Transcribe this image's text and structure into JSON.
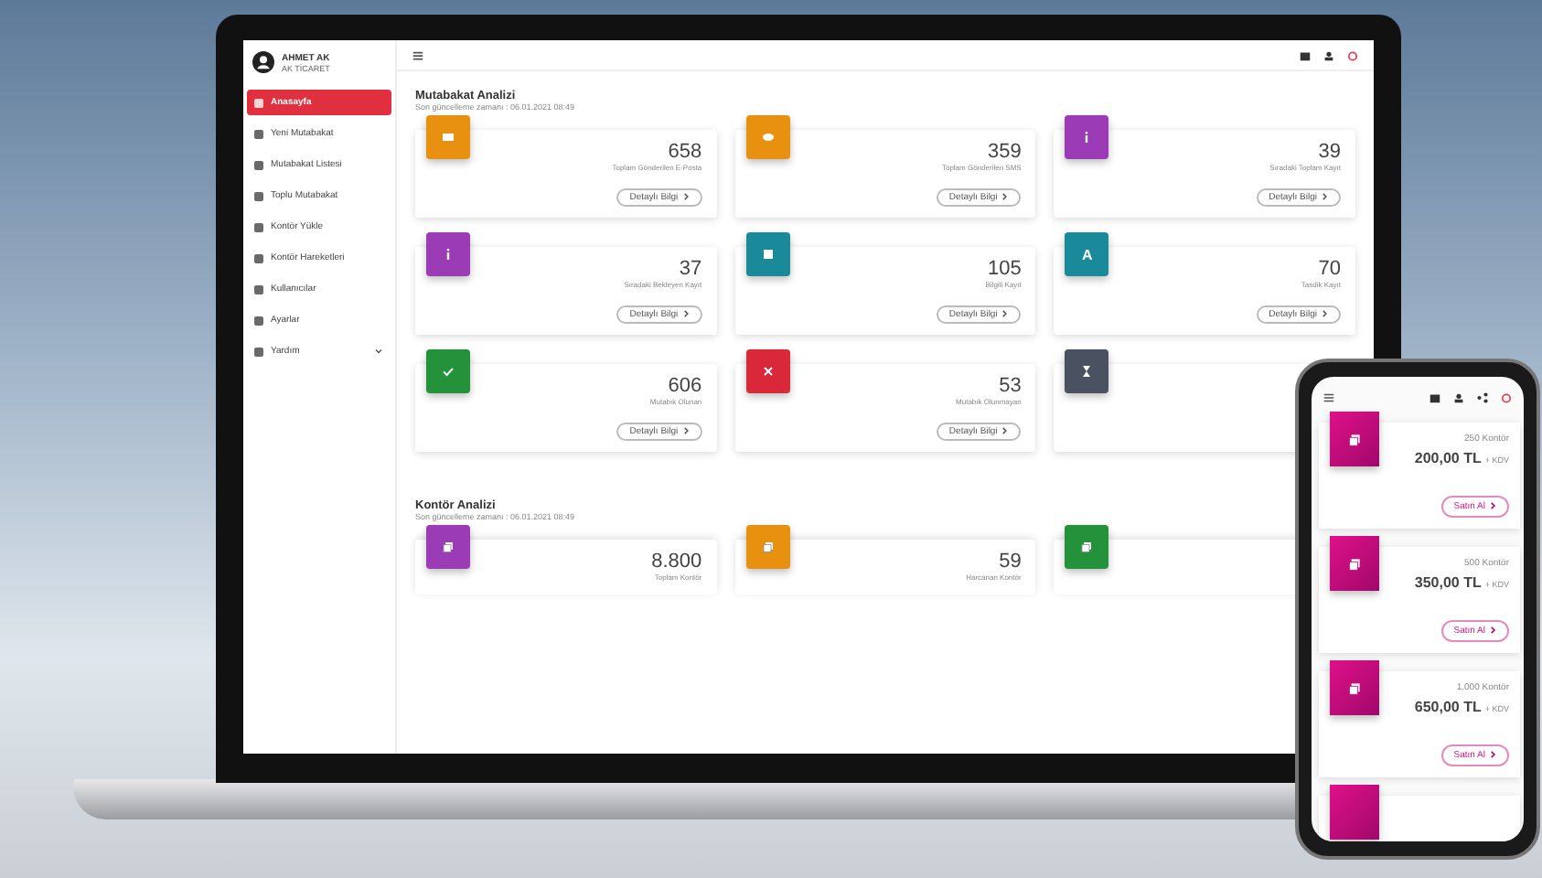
{
  "user": {
    "name": "AHMET AK",
    "company": "AK TİCARET"
  },
  "sidebar": {
    "items": [
      {
        "label": "Anasayfa",
        "selected": true
      },
      {
        "label": "Yeni Mutabakat",
        "selected": false
      },
      {
        "label": "Mutabakat Listesi",
        "selected": false
      },
      {
        "label": "Toplu Mutabakat",
        "selected": false
      },
      {
        "label": "Kontör Yükle",
        "selected": false
      },
      {
        "label": "Kontör Hareketleri",
        "selected": false
      },
      {
        "label": "Kullanıcılar",
        "selected": false
      },
      {
        "label": "Ayarlar",
        "selected": false
      },
      {
        "label": "Yardım",
        "selected": false,
        "expandable": true
      }
    ]
  },
  "sections": [
    {
      "title": "Mutabakat Analizi",
      "updated": "Son güncelleme zamanı : 06.01.2021 08:49",
      "cards": [
        {
          "color": "#e8900f",
          "value": "658",
          "label": "Toplam Gönderilen E-Posta",
          "button": "Detaylı Bilgi"
        },
        {
          "color": "#e8900f",
          "value": "359",
          "label": "Toplam Gönderilen SMS",
          "button": "Detaylı Bilgi"
        },
        {
          "color": "#9b3bb5",
          "value": "39",
          "label": "Sıradaki Toplam Kayıt",
          "button": "Detaylı Bilgi"
        },
        {
          "color": "#9b3bb5",
          "value": "37",
          "label": "Sıradaki Bekleyen Kayıt",
          "button": "Detaylı Bilgi"
        },
        {
          "color": "#1a8a9a",
          "value": "105",
          "label": "Bilgili Kayıt",
          "button": "Detaylı Bilgi"
        },
        {
          "color": "#1a8a9a",
          "icon_text": "A",
          "value": "70",
          "label": "Tasdik Kayıt",
          "button": "Detaylı Bilgi"
        },
        {
          "color": "#23923a",
          "value": "606",
          "label": "Mutabık Olunan",
          "button": "Detaylı Bilgi"
        },
        {
          "color": "#d8283a",
          "value": "53",
          "label": "Mutabık Olunmayan",
          "button": "Detaylı Bilgi"
        },
        {
          "color": "#4a5160"
        }
      ]
    },
    {
      "title": "Kontör Analizi",
      "updated": "Son güncelleme zamanı : 06.01.2021 08:49",
      "cards": [
        {
          "color": "#9b3bb5",
          "value": "8.800",
          "label": "Toplam Kontör"
        },
        {
          "color": "#e8900f",
          "value": "59",
          "label": "Harcanan Kontör"
        },
        {
          "color": "#23923a"
        }
      ]
    }
  ],
  "phone": {
    "packages": [
      {
        "credits": "250 Kontör",
        "price": "200,00 TL",
        "tax": "+ KDV",
        "button": "Satın Al"
      },
      {
        "credits": "500 Kontör",
        "price": "350,00 TL",
        "tax": "+ KDV",
        "button": "Satın Al"
      },
      {
        "credits": "1.000 Kontör",
        "price": "650,00 TL",
        "tax": "+ KDV",
        "button": "Satın Al"
      }
    ]
  }
}
